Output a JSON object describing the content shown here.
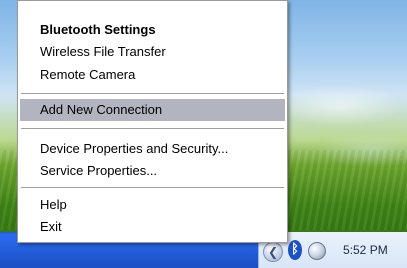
{
  "menu": {
    "group1": [
      {
        "label": "Bluetooth Settings"
      },
      {
        "label": "Wireless File Transfer"
      },
      {
        "label": "Remote Camera"
      }
    ],
    "group2": [
      {
        "label": "Add New Connection"
      }
    ],
    "group3": [
      {
        "label": "Device Properties and Security..."
      },
      {
        "label": "Service Properties..."
      }
    ],
    "group4": [
      {
        "label": "Help"
      },
      {
        "label": "Exit"
      }
    ],
    "highlight_color": "#b2b4bf"
  },
  "tray": {
    "clock": "5:52 PM",
    "chevron_glyph": "❮",
    "bluetooth_glyph": "ᛒ"
  },
  "colors": {
    "taskbar": "#245edb",
    "tray": "#d9e6f8"
  }
}
